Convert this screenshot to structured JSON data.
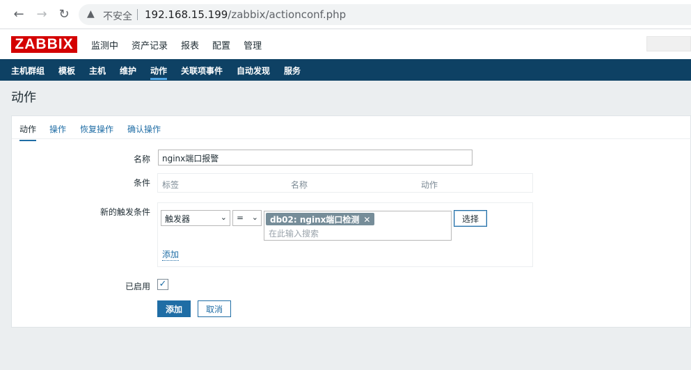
{
  "browser": {
    "back_icon": "arrow-left-icon",
    "forward_icon": "arrow-right-icon",
    "reload_icon": "reload-icon",
    "warning_icon": "warning-triangle-icon",
    "insecure_label": "不安全",
    "url_host": "192.168.15.199",
    "url_path": "/zabbix/actionconf.php"
  },
  "header": {
    "logo": "ZABBIX",
    "menu": [
      "监测中",
      "资产记录",
      "报表",
      "配置",
      "管理"
    ],
    "active_menu": "配置"
  },
  "subnav": {
    "items": [
      "主机群组",
      "模板",
      "主机",
      "维护",
      "动作",
      "关联项事件",
      "自动发现",
      "服务"
    ],
    "selected": "动作"
  },
  "page": {
    "title": "动作"
  },
  "tabs": [
    "动作",
    "操作",
    "恢复操作",
    "确认操作"
  ],
  "form": {
    "name_label": "名称",
    "name_value": "nginx端口报警",
    "conditions_label": "条件",
    "conditions_columns": [
      "标签",
      "名称",
      "动作"
    ],
    "new_condition_label": "新的触发条件",
    "condition_type": "触发器",
    "condition_operator": "=",
    "selected_chip": "db02: nginx端口检测",
    "search_placeholder": "在此输入搜索",
    "select_button": "选择",
    "add_link": "添加",
    "enabled_label": "已启用",
    "enabled": true,
    "add_button": "添加",
    "cancel_button": "取消"
  },
  "colors": {
    "accent": "#1f6da5",
    "subnav_bg": "#0e4164",
    "logo_red": "#d40000"
  }
}
